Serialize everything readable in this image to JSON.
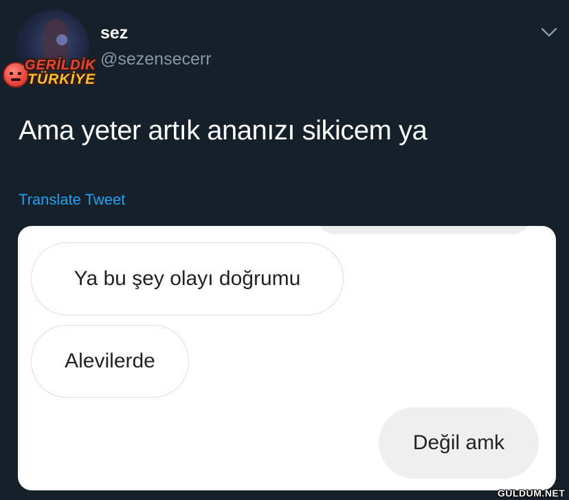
{
  "tweet": {
    "display_name": "sez",
    "handle": "@sezensecerr",
    "text": "Ama yeter artık ananızı sikicem ya",
    "translate_label": "Translate Tweet",
    "menu_icon": "chevron-down-icon"
  },
  "overlay_logo": {
    "line1": "GERİLDİK",
    "line2": "TÜRKİYE",
    "icon": "angry-face-icon"
  },
  "chat": {
    "messages": [
      {
        "side": "received",
        "text": "Ya bu şey olayı doğrumu"
      },
      {
        "side": "received",
        "text": "Alevilerde"
      },
      {
        "side": "sent",
        "text": "Değil amk"
      }
    ]
  },
  "watermark": "GULDUM.NET",
  "colors": {
    "background": "#15202b",
    "link": "#1da1f2",
    "secondary_text": "#8899a6",
    "card": "#ffffff"
  }
}
